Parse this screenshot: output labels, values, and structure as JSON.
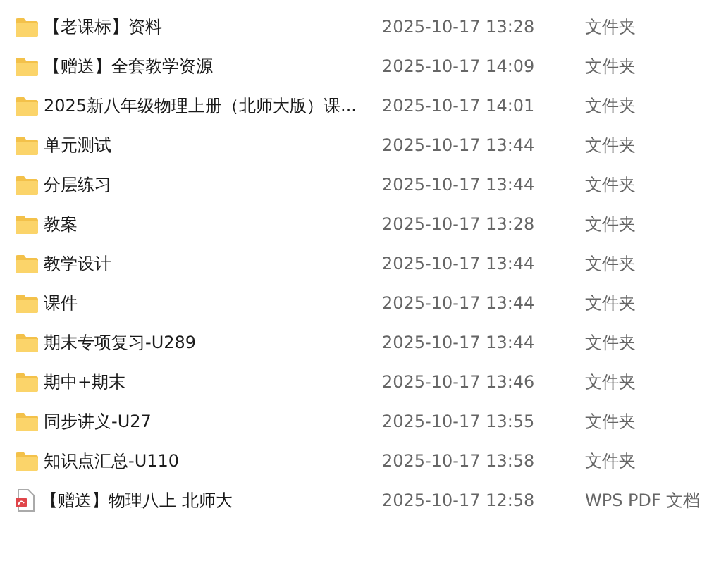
{
  "files": [
    {
      "kind": "folder",
      "name": "【老课标】资料",
      "modified": "2025-10-17 13:28",
      "type": "文件夹"
    },
    {
      "kind": "folder",
      "name": "【赠送】全套教学资源",
      "modified": "2025-10-17 14:09",
      "type": "文件夹"
    },
    {
      "kind": "folder",
      "name": "2025新八年级物理上册（北师大版）课...",
      "modified": "2025-10-17 14:01",
      "type": "文件夹"
    },
    {
      "kind": "folder",
      "name": "单元测试",
      "modified": "2025-10-17 13:44",
      "type": "文件夹"
    },
    {
      "kind": "folder",
      "name": "分层练习",
      "modified": "2025-10-17 13:44",
      "type": "文件夹"
    },
    {
      "kind": "folder",
      "name": "教案",
      "modified": "2025-10-17 13:28",
      "type": "文件夹"
    },
    {
      "kind": "folder",
      "name": "教学设计",
      "modified": "2025-10-17 13:44",
      "type": "文件夹"
    },
    {
      "kind": "folder",
      "name": "课件",
      "modified": "2025-10-17 13:44",
      "type": "文件夹"
    },
    {
      "kind": "folder",
      "name": "期末专项复习-U289",
      "modified": "2025-10-17 13:44",
      "type": "文件夹"
    },
    {
      "kind": "folder",
      "name": "期中+期末",
      "modified": "2025-10-17 13:46",
      "type": "文件夹"
    },
    {
      "kind": "folder",
      "name": "同步讲义-U27",
      "modified": "2025-10-17 13:55",
      "type": "文件夹"
    },
    {
      "kind": "folder",
      "name": "知识点汇总-U110",
      "modified": "2025-10-17 13:58",
      "type": "文件夹"
    },
    {
      "kind": "pdf",
      "name": "【赠送】物理八上 北师大",
      "modified": "2025-10-17 12:58",
      "type": "WPS PDF 文档"
    }
  ]
}
